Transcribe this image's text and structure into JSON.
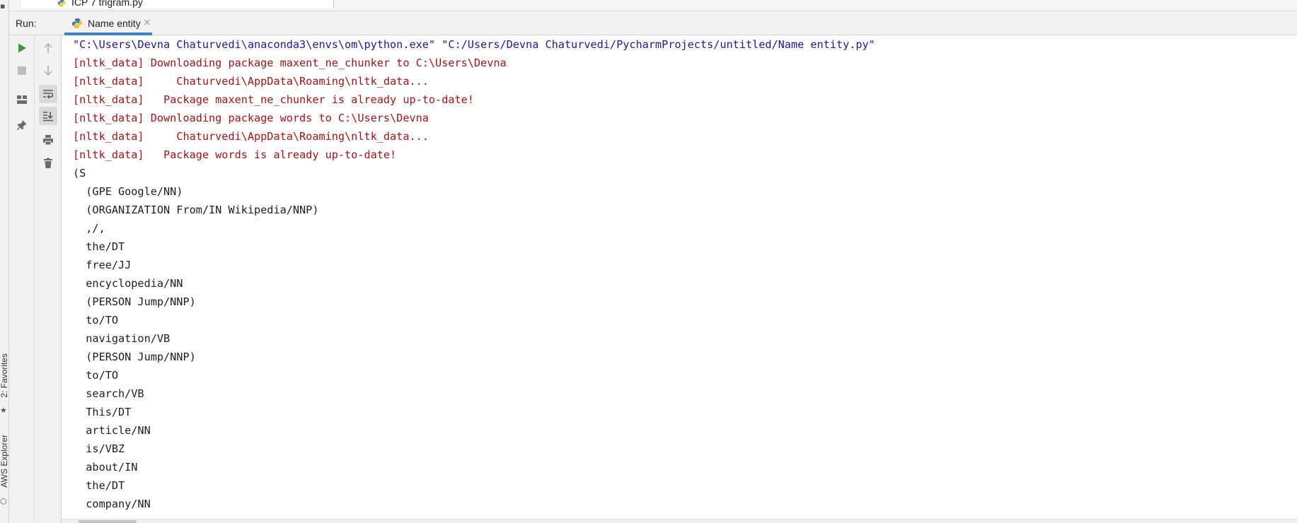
{
  "side_strip": {
    "favorites_label": "2: Favorites",
    "aws_label": "AWS Explorer"
  },
  "tree": {
    "file_label": "ICP 7 trigram.py"
  },
  "run": {
    "label": "Run:",
    "tab_title": "Name entity",
    "tab_close": "×"
  },
  "toolbar": {
    "run_icon": "play-icon",
    "stop_icon": "stop-icon",
    "layout_icon": "layout-icon",
    "pin_icon": "pin-icon",
    "up_icon": "arrow-up-icon",
    "down_icon": "arrow-down-icon",
    "wrap_icon": "soft-wrap-icon",
    "scroll_end_icon": "scroll-to-end-icon",
    "print_icon": "print-icon",
    "trash_icon": "trash-icon"
  },
  "colors": {
    "command": "#1a1a9a",
    "stderr": "#a01515",
    "stdout": "#1e1e1e",
    "tab_accent": "#4083c9",
    "run_green": "#3c9b3c"
  },
  "console": {
    "lines": [
      {
        "kind": "cmd",
        "text": "\"C:\\Users\\Devna Chaturvedi\\anaconda3\\envs\\om\\python.exe\" \"C:/Users/Devna Chaturvedi/PycharmProjects/untitled/Name entity.py\""
      },
      {
        "kind": "err",
        "text": "[nltk_data] Downloading package maxent_ne_chunker to C:\\Users\\Devna"
      },
      {
        "kind": "err",
        "text": "[nltk_data]     Chaturvedi\\AppData\\Roaming\\nltk_data..."
      },
      {
        "kind": "err",
        "text": "[nltk_data]   Package maxent_ne_chunker is already up-to-date!"
      },
      {
        "kind": "err",
        "text": "[nltk_data] Downloading package words to C:\\Users\\Devna"
      },
      {
        "kind": "err",
        "text": "[nltk_data]     Chaturvedi\\AppData\\Roaming\\nltk_data..."
      },
      {
        "kind": "err",
        "text": "[nltk_data]   Package words is already up-to-date!"
      },
      {
        "kind": "out",
        "text": "(S"
      },
      {
        "kind": "out",
        "text": "  (GPE Google/NN)"
      },
      {
        "kind": "out",
        "text": "  (ORGANIZATION From/IN Wikipedia/NNP)"
      },
      {
        "kind": "out",
        "text": "  ,/,"
      },
      {
        "kind": "out",
        "text": "  the/DT"
      },
      {
        "kind": "out",
        "text": "  free/JJ"
      },
      {
        "kind": "out",
        "text": "  encyclopedia/NN"
      },
      {
        "kind": "out",
        "text": "  (PERSON Jump/NNP)"
      },
      {
        "kind": "out",
        "text": "  to/TO"
      },
      {
        "kind": "out",
        "text": "  navigation/VB"
      },
      {
        "kind": "out",
        "text": "  (PERSON Jump/NNP)"
      },
      {
        "kind": "out",
        "text": "  to/TO"
      },
      {
        "kind": "out",
        "text": "  search/VB"
      },
      {
        "kind": "out",
        "text": "  This/DT"
      },
      {
        "kind": "out",
        "text": "  article/NN"
      },
      {
        "kind": "out",
        "text": "  is/VBZ"
      },
      {
        "kind": "out",
        "text": "  about/IN"
      },
      {
        "kind": "out",
        "text": "  the/DT"
      },
      {
        "kind": "out",
        "text": "  company/NN"
      }
    ]
  }
}
